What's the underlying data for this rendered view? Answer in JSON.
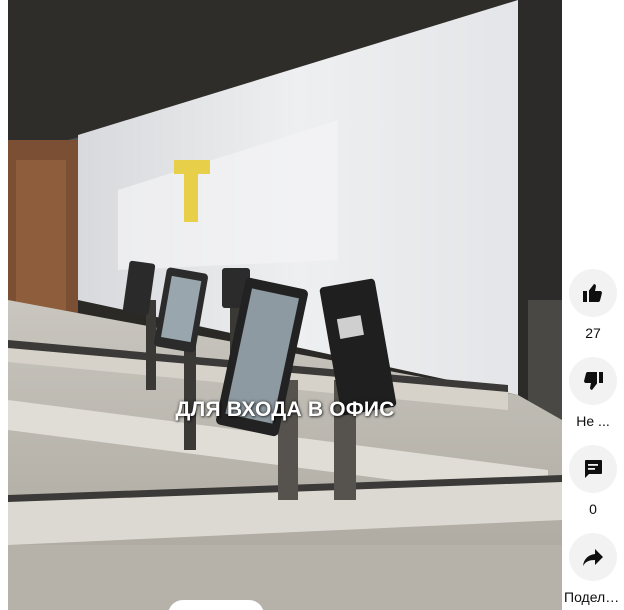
{
  "video": {
    "caption": "ДЛЯ ВХОДА В ОФИС"
  },
  "actions": {
    "like": {
      "icon": "thumbs-up-icon",
      "label": "27"
    },
    "dislike": {
      "icon": "thumbs-down-icon",
      "label": "Не ..."
    },
    "comments": {
      "icon": "comment-icon",
      "label": "0"
    },
    "share": {
      "icon": "share-icon",
      "label": "Подели..."
    }
  },
  "colors": {
    "button_bg": "#f2f2f2",
    "text": "#0f0f0f",
    "caption": "#ffffff"
  }
}
